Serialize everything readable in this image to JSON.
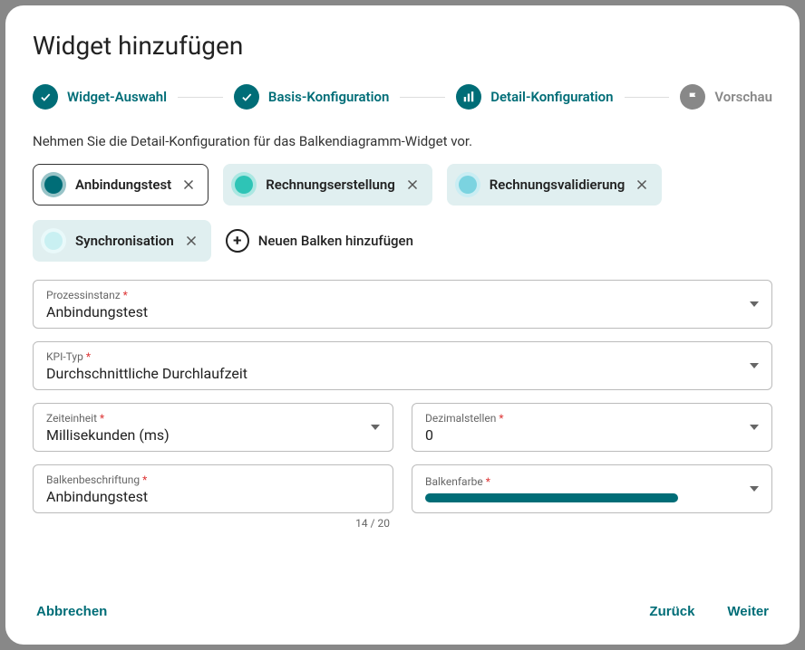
{
  "dialog": {
    "title": "Widget hinzufügen",
    "instruction": "Nehmen Sie die Detail-Konfiguration für das Balkendiagramm-Widget vor."
  },
  "stepper": {
    "steps": [
      {
        "label": "Widget-Auswahl",
        "state": "done"
      },
      {
        "label": "Basis-Konfiguration",
        "state": "done"
      },
      {
        "label": "Detail-Konfiguration",
        "state": "current"
      },
      {
        "label": "Vorschau",
        "state": "pending"
      }
    ]
  },
  "chips": [
    {
      "label": "Anbindungstest",
      "color": "#006d77",
      "selected": true
    },
    {
      "label": "Rechnungserstellung",
      "color": "#2ec4b6",
      "selected": false
    },
    {
      "label": "Rechnungsvalidierung",
      "color": "#7bd3e0",
      "selected": false
    },
    {
      "label": "Synchronisation",
      "color": "#c9f0f2",
      "selected": false
    }
  ],
  "addBar": {
    "label": "Neuen Balken hinzufügen"
  },
  "fields": {
    "prozessinstanz": {
      "label": "Prozessinstanz",
      "value": "Anbindungstest"
    },
    "kpiTyp": {
      "label": "KPI-Typ",
      "value": "Durchschnittliche Durchlaufzeit"
    },
    "zeiteinheit": {
      "label": "Zeiteinheit",
      "value": "Millisekunden (ms)"
    },
    "dezimalstellen": {
      "label": "Dezimalstellen",
      "value": "0"
    },
    "balkenbeschriftung": {
      "label": "Balkenbeschriftung",
      "value": "Anbindungstest",
      "count": "14 / 20"
    },
    "balkenfarbe": {
      "label": "Balkenfarbe",
      "color": "#006d77"
    }
  },
  "actions": {
    "cancel": "Abbrechen",
    "back": "Zurück",
    "next": "Weiter"
  }
}
